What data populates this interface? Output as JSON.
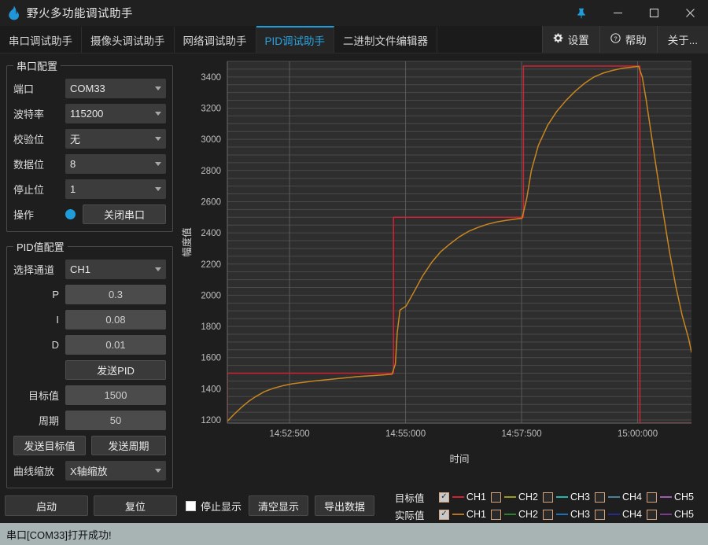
{
  "window": {
    "title": "野火多功能调试助手",
    "logo_icon": "flame-icon",
    "pin_icon": "pin-icon",
    "minimize_icon": "minimize-icon",
    "maximize_icon": "maximize-icon",
    "close_icon": "close-icon",
    "accent": "#1f9ddb"
  },
  "tabs": [
    {
      "label": "串口调试助手",
      "active": false
    },
    {
      "label": "摄像头调试助手",
      "active": false
    },
    {
      "label": "网络调试助手",
      "active": false
    },
    {
      "label": "PID调试助手",
      "active": true
    },
    {
      "label": "二进制文件编辑器",
      "active": false
    }
  ],
  "tab_right": [
    {
      "label": "设置",
      "icon": "gear-icon"
    },
    {
      "label": "帮助",
      "icon": "question-circle-icon"
    },
    {
      "label": "关于...",
      "icon": ""
    }
  ],
  "serial_group": {
    "legend": "串口配置",
    "rows": [
      {
        "label": "端口",
        "value": "COM33"
      },
      {
        "label": "波特率",
        "value": "115200"
      },
      {
        "label": "校验位",
        "value": "无"
      },
      {
        "label": "数据位",
        "value": "8"
      },
      {
        "label": "停止位",
        "value": "1"
      }
    ],
    "action_label": "操作",
    "action_button": "关闭串口",
    "indicator_color": "#1f9ddb"
  },
  "pid_group": {
    "legend": "PID值配置",
    "channel_label": "选择通道",
    "channel_value": "CH1",
    "p_label": "P",
    "p_value": "0.3",
    "i_label": "I",
    "i_value": "0.08",
    "d_label": "D",
    "d_value": "0.01",
    "send_pid_label": "发送PID",
    "target_label": "目标值",
    "target_value": "1500",
    "period_label": "周期",
    "period_value": "50",
    "send_target_label": "发送目标值",
    "send_period_label": "发送周期",
    "zoom_label": "曲线缩放",
    "zoom_value": "X轴缩放"
  },
  "bottom": {
    "start_label": "启动",
    "reset_label": "复位",
    "stop_display_label": "停止显示",
    "stop_display_checked": false,
    "clear_label": "清空显示",
    "export_label": "导出数据"
  },
  "legend_panel": {
    "rows": [
      {
        "label": "目标值",
        "items": [
          {
            "name": "CH1",
            "checked": true,
            "color": "#d42030"
          },
          {
            "name": "CH2",
            "checked": false,
            "color": "#9a9a1e"
          },
          {
            "name": "CH3",
            "checked": false,
            "color": "#1fb6b6"
          },
          {
            "name": "CH4",
            "checked": false,
            "color": "#4a7f9e"
          },
          {
            "name": "CH5",
            "checked": false,
            "color": "#a05ab0"
          }
        ]
      },
      {
        "label": "实际值",
        "items": [
          {
            "name": "CH1",
            "checked": true,
            "color": "#b57327"
          },
          {
            "name": "CH2",
            "checked": false,
            "color": "#2f7f2f"
          },
          {
            "name": "CH3",
            "checked": false,
            "color": "#1f6fb8"
          },
          {
            "name": "CH4",
            "checked": false,
            "color": "#2a2a8c"
          },
          {
            "name": "CH5",
            "checked": false,
            "color": "#7a3b8a"
          }
        ]
      }
    ]
  },
  "statusbar": {
    "text": "串口[COM33]打开成功!"
  },
  "chart_data": {
    "type": "line",
    "title": "",
    "xlabel": "时间",
    "ylabel": "幅度值",
    "grid": true,
    "legend_position": "bottom-external",
    "ylim": [
      1180,
      3500
    ],
    "yticks": [
      1200,
      1400,
      1600,
      1800,
      2000,
      2200,
      2400,
      2600,
      2800,
      3000,
      3200,
      3400
    ],
    "y_minor_step": 50,
    "xlim": [
      0,
      100
    ],
    "xticks": [
      13.4,
      38.4,
      63.4,
      88.4
    ],
    "xticklabels": [
      "14:52:500",
      "14:55:000",
      "14:57:500",
      "15:00:000"
    ],
    "series": [
      {
        "name": "目标值 CH1",
        "color": "#d42030",
        "type": "step",
        "x": [
          0,
          0,
          35.8,
          35.8,
          63.8,
          63.8,
          88.9,
          88.9,
          100
        ],
        "y": [
          1180,
          1500,
          1500,
          2500,
          2500,
          3470,
          3470,
          1180,
          1180
        ]
      },
      {
        "name": "实际值 CH1",
        "color": "#c8861f",
        "type": "line",
        "x": [
          0,
          1.5,
          3,
          4.5,
          6,
          8,
          10,
          12,
          14,
          16,
          18,
          20,
          22,
          24,
          26,
          28,
          30,
          32,
          34,
          35.5,
          36.2,
          36.6,
          37.2,
          38.5,
          40,
          42,
          44,
          46,
          48,
          50,
          52,
          54,
          56,
          58,
          60,
          62,
          63.5,
          64.5,
          65.5,
          67,
          69,
          71,
          73,
          75,
          77,
          79,
          81,
          83,
          85,
          87,
          88.6,
          89.4,
          90.2,
          91.2,
          92.4,
          93.8,
          95.2,
          96.6,
          98,
          99.4,
          100
        ],
        "y": [
          1192,
          1238,
          1280,
          1318,
          1348,
          1382,
          1404,
          1420,
          1432,
          1440,
          1448,
          1454,
          1460,
          1466,
          1472,
          1478,
          1482,
          1486,
          1490,
          1494,
          1560,
          1760,
          1905,
          1930,
          2010,
          2120,
          2210,
          2280,
          2330,
          2375,
          2410,
          2435,
          2455,
          2470,
          2480,
          2488,
          2494,
          2620,
          2800,
          2960,
          3090,
          3180,
          3250,
          3310,
          3360,
          3400,
          3425,
          3442,
          3455,
          3462,
          3468,
          3400,
          3260,
          3060,
          2820,
          2550,
          2290,
          2060,
          1870,
          1720,
          1635
        ]
      }
    ]
  }
}
